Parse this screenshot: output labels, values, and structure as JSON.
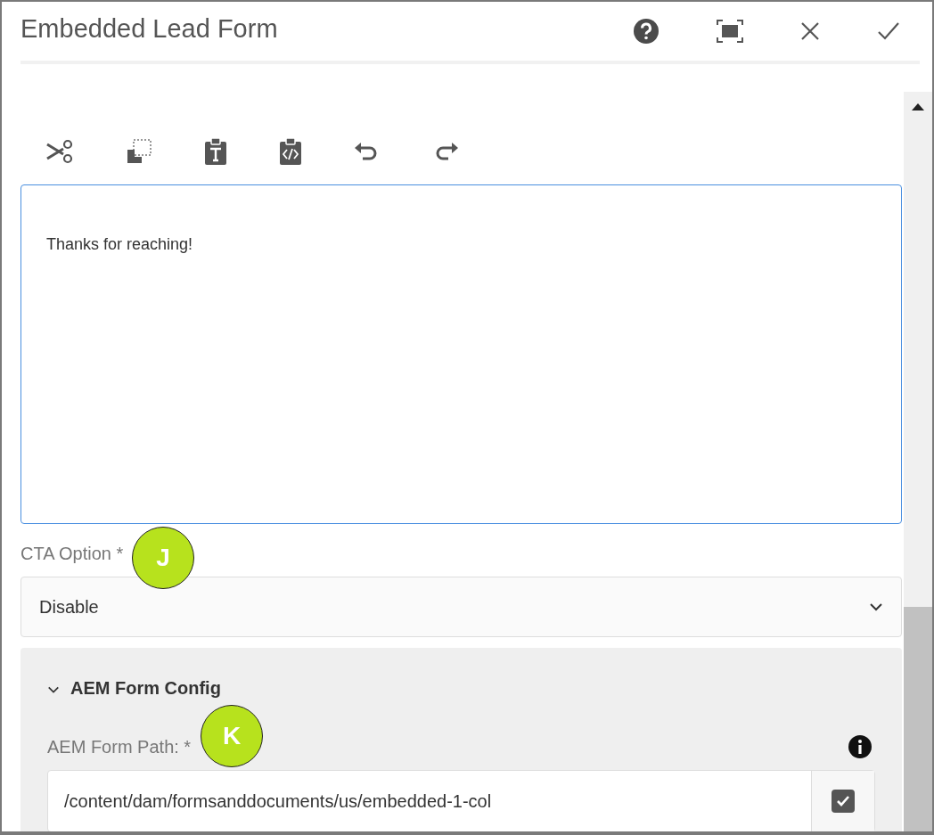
{
  "dialog": {
    "title": "Embedded Lead Form"
  },
  "editor": {
    "text": "Thanks for reaching!"
  },
  "cta_option": {
    "label": "CTA Option *",
    "value": "Disable"
  },
  "section": {
    "title": "AEM Form Config",
    "expanded": true,
    "field": {
      "label": "AEM Form Path: *",
      "value": "/content/dam/formsanddocuments/us/embedded-1-col",
      "checked": true
    }
  },
  "callouts": [
    {
      "letter": "J"
    },
    {
      "letter": "K"
    }
  ]
}
